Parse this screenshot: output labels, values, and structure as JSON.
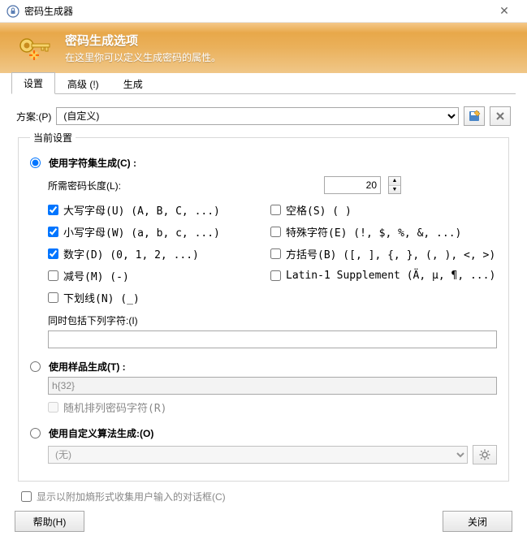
{
  "window": {
    "title": "密码生成器"
  },
  "banner": {
    "title": "密码生成选项",
    "subtitle": "在这里你可以定义生成密码的属性。"
  },
  "tabs": {
    "t0": "设置",
    "t1": "高级 (!)",
    "t2": "生成"
  },
  "scheme": {
    "label": "方案:(P)",
    "selected": "(自定义)"
  },
  "group": {
    "legend": "当前设置"
  },
  "modes": {
    "charset": {
      "label": "使用字符集生成(C) :",
      "checked": true
    },
    "pattern": {
      "label": "使用样品生成(T) :",
      "checked": false,
      "value": "h{32}",
      "shuffle": "随机排列密码字符(R)"
    },
    "custom": {
      "label": "使用自定义算法生成:(O)",
      "checked": false,
      "algo": "(无)"
    }
  },
  "length": {
    "label": "所需密码长度(L):",
    "value": "20"
  },
  "checks": {
    "upper": {
      "label": "大写字母(U) (A, B, C, ...)",
      "checked": true
    },
    "lower": {
      "label": "小写字母(W) (a, b, c, ...)",
      "checked": true
    },
    "digits": {
      "label": "数字(D) (0, 1, 2, ...)",
      "checked": true
    },
    "minus": {
      "label": "减号(M) (-)",
      "checked": false
    },
    "under": {
      "label": "下划线(N) (_)",
      "checked": false
    },
    "space": {
      "label": "空格(S) ( )",
      "checked": false
    },
    "special": {
      "label": "特殊字符(E) (!, $, %, &, ...)",
      "checked": false
    },
    "bracket": {
      "label": "方括号(B) ([, ], {, }, (, ), <, >)",
      "checked": false
    },
    "latin1": {
      "label": "Latin-1 Supplement (Ä, µ, ¶, ...)",
      "checked": false
    }
  },
  "include": {
    "label": "同时包括下列字符:(I)",
    "value": ""
  },
  "entropy": {
    "label": "显示以附加熵形式收集用户输入的对话框(C)",
    "checked": false
  },
  "buttons": {
    "help": "帮助(H)",
    "close": "关闭"
  }
}
